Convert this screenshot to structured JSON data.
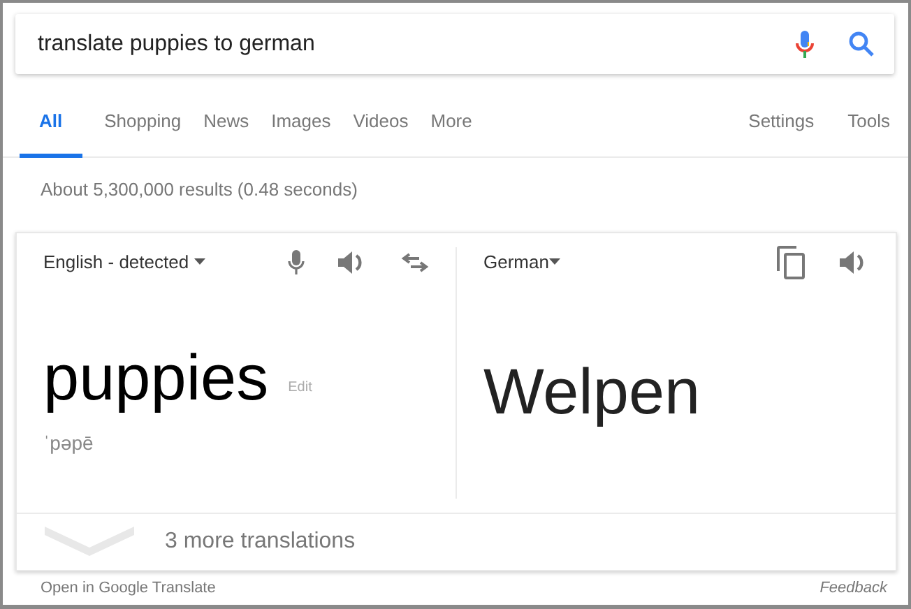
{
  "search": {
    "value": "translate puppies to german"
  },
  "tabs": [
    {
      "label": "All",
      "selected": true
    },
    {
      "label": "Shopping",
      "selected": false
    },
    {
      "label": "News",
      "selected": false
    },
    {
      "label": "Images",
      "selected": false
    },
    {
      "label": "Videos",
      "selected": false
    },
    {
      "label": "More",
      "selected": false
    }
  ],
  "tools": [
    "Settings",
    "Tools"
  ],
  "result_stats": "About 5,300,000 results (0.48 seconds)",
  "translator": {
    "source": {
      "language": "English - detected",
      "text": "puppies",
      "edit": "Edit",
      "phonetic": "ˈpəpē"
    },
    "target": {
      "language": "German",
      "text": "Welpen"
    },
    "more": "3 more translations"
  },
  "footer": {
    "open": "Open in Google Translate",
    "feedback": "Feedback"
  }
}
